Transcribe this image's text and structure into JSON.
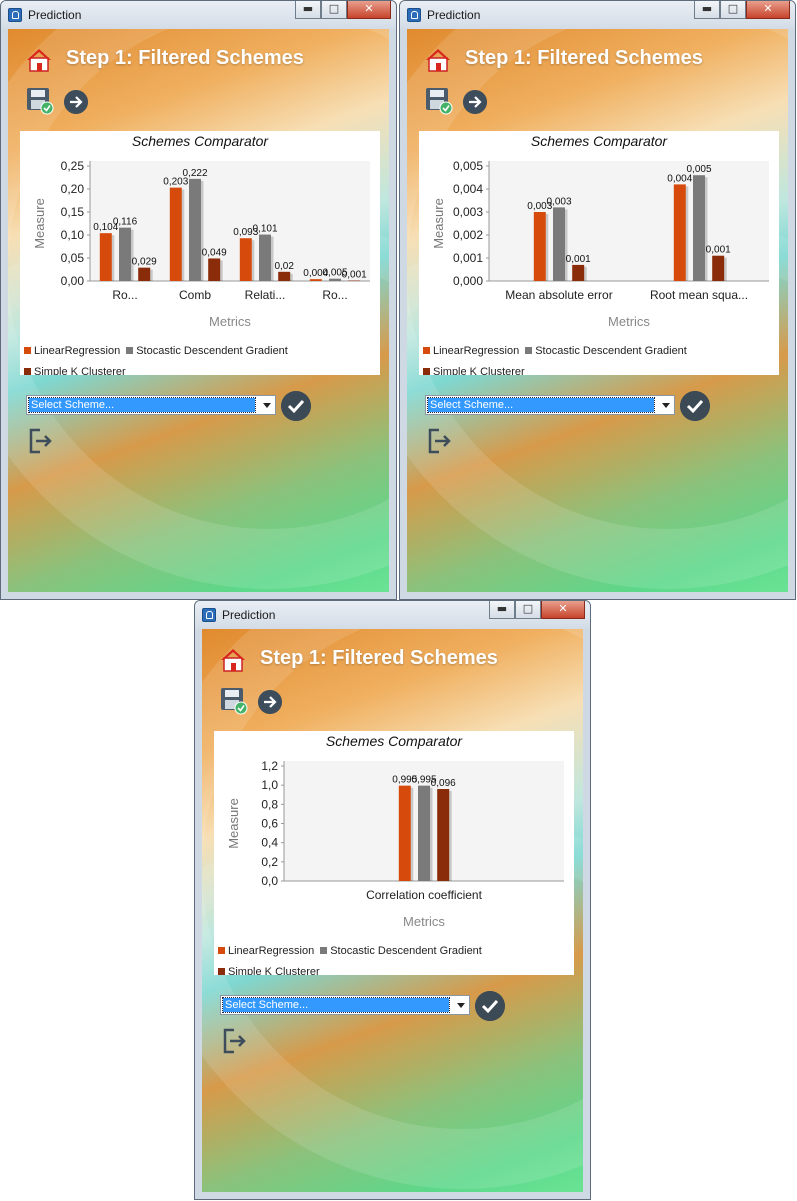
{
  "windows": [
    {
      "title": "Prediction",
      "step_title": "Step 1: Filtered Schemes",
      "select_value": "Select Scheme...",
      "chart_data": {
        "type": "bar",
        "title": "Schemes Comparator",
        "xlabel": "Metrics",
        "ylabel": "Measure",
        "ylim": [
          0,
          0.25
        ],
        "y_ticks": [
          "0,00",
          "0,05",
          "0,10",
          "0,15",
          "0,20",
          "0,25"
        ],
        "categories": [
          "Ro...",
          "Comb",
          "Relati...",
          "Ro..."
        ],
        "series": [
          {
            "name": "LinearRegression",
            "values": [
              0.104,
              0.203,
              0.093,
              0.004
            ]
          },
          {
            "name": "Stocastic Descendent Gradient",
            "values": [
              0.116,
              0.222,
              0.101,
              0.005
            ]
          },
          {
            "name": "Simple K Clusterer",
            "values": [
              0.029,
              0.049,
              0.02,
              0.001
            ]
          }
        ],
        "value_labels": [
          [
            "0,104",
            "0,203",
            "0,093",
            "0,004"
          ],
          [
            "0,116",
            "0,222",
            "0,101",
            "0,005"
          ],
          [
            "0,029",
            "0,049",
            "0,02",
            "0,001"
          ]
        ],
        "legend_position": "bottom",
        "grid": false
      }
    },
    {
      "title": "Prediction",
      "step_title": "Step 1: Filtered Schemes",
      "select_value": "Select Scheme...",
      "chart_data": {
        "type": "bar",
        "title": "Schemes Comparator",
        "xlabel": "Metrics",
        "ylabel": "Measure",
        "ylim": [
          0,
          0.005
        ],
        "y_ticks": [
          "0,000",
          "0,001",
          "0,002",
          "0,003",
          "0,004",
          "0,005"
        ],
        "categories": [
          "Mean absolute error",
          "Root mean squa..."
        ],
        "series": [
          {
            "name": "LinearRegression",
            "values": [
              0.003,
              0.0042
            ]
          },
          {
            "name": "Stocastic Descendent Gradient",
            "values": [
              0.0032,
              0.0046
            ]
          },
          {
            "name": "Simple K Clusterer",
            "values": [
              0.0007,
              0.0011
            ]
          }
        ],
        "value_labels": [
          [
            "0,003",
            "0,004"
          ],
          [
            "0,003",
            "0,005"
          ],
          [
            "0,001",
            "0,001"
          ]
        ],
        "legend_position": "bottom",
        "grid": false
      }
    },
    {
      "title": "Prediction",
      "step_title": "Step 1: Filtered Schemes",
      "select_value": "Select Scheme...",
      "chart_data": {
        "type": "bar",
        "title": "Schemes Comparator",
        "xlabel": "Metrics",
        "ylabel": "Measure",
        "ylim": [
          0,
          1.2
        ],
        "y_ticks": [
          "0,0",
          "0,2",
          "0,4",
          "0,6",
          "0,8",
          "1,0",
          "1,2"
        ],
        "categories": [
          "Correlation coefficient"
        ],
        "series": [
          {
            "name": "LinearRegression",
            "values": [
              0.995
            ]
          },
          {
            "name": "Stocastic Descendent Gradient",
            "values": [
              0.995
            ]
          },
          {
            "name": "Simple K Clusterer",
            "values": [
              0.96
            ]
          }
        ],
        "value_labels": [
          [
            "0,995"
          ],
          [
            "0,995"
          ],
          [
            "0,096"
          ]
        ],
        "legend_position": "bottom",
        "grid": false
      }
    }
  ],
  "colors": {
    "linear_regression": "#d64b0c",
    "sdg": "#7a7a7a",
    "simple_k": "#8a2c0a",
    "select_highlight": "#3399ff"
  },
  "icons": [
    "home-icon",
    "save-icon",
    "next-arrow-icon",
    "confirm-check-icon",
    "exit-icon",
    "app-icon"
  ]
}
